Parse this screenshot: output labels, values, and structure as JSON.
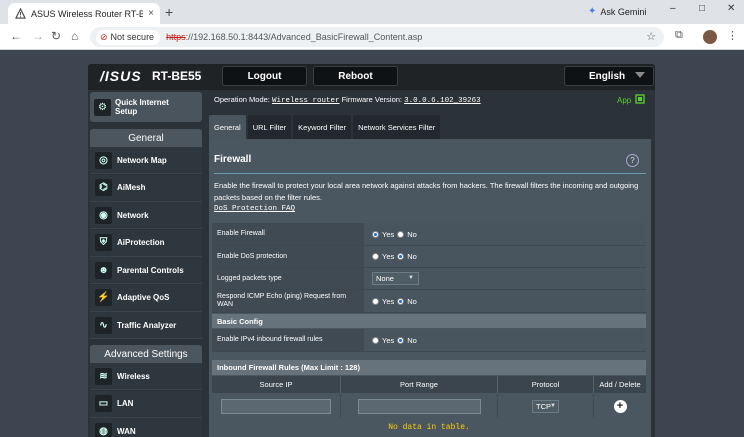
{
  "browser": {
    "tab_title": "ASUS Wireless Router RT-BE55",
    "tab_close": "×",
    "new_tab": "+",
    "gemini_label": "Ask Gemini",
    "not_secure": "Not secure",
    "url_scheme": "https",
    "url_rest": "://192.168.50.1:8443/Advanced_BasicFirewall_Content.asp",
    "minimize": "–",
    "maximize": "□",
    "close": "✕"
  },
  "router": {
    "brand": "/ISUS",
    "model": "RT-BE55",
    "logout": "Logout",
    "reboot": "Reboot",
    "language": "English",
    "qis_label_1": "Quick Internet",
    "qis_label_2": "Setup",
    "opmode_label": "Operation Mode:",
    "opmode_value": "Wireless router",
    "fw_label": "Firmware Version:",
    "fw_value": "3.0.0.6.102_39263",
    "app_label": "App"
  },
  "sidebar": {
    "general_head": "General",
    "general_items": [
      {
        "label": "Network Map",
        "icon": "network-map-icon"
      },
      {
        "label": "AiMesh",
        "icon": "aimesh-icon"
      },
      {
        "label": "Network",
        "icon": "network-icon"
      },
      {
        "label": "AiProtection",
        "icon": "aiprotection-icon"
      },
      {
        "label": "Parental Controls",
        "icon": "parental-controls-icon"
      },
      {
        "label": "Adaptive QoS",
        "icon": "adaptive-qos-icon"
      },
      {
        "label": "Traffic Analyzer",
        "icon": "traffic-analyzer-icon"
      }
    ],
    "advanced_head": "Advanced Settings",
    "advanced_items": [
      {
        "label": "Wireless",
        "icon": "wireless-icon"
      },
      {
        "label": "LAN",
        "icon": "lan-icon"
      },
      {
        "label": "WAN",
        "icon": "wan-icon"
      }
    ]
  },
  "tabs": [
    "General",
    "URL Filter",
    "Keyword Filter",
    "Network Services Filter"
  ],
  "panel": {
    "title": "Firewall",
    "help": "?",
    "description": "Enable the firewall to protect your local area network against attacks from hackers. The firewall filters the incoming and outgoing packets based on the filter rules.",
    "faq_link": "DoS Protection FAQ",
    "yes": "Yes",
    "no": "No",
    "rows": [
      {
        "label": "Enable Firewall",
        "selected": "Yes"
      },
      {
        "label": "Enable DoS protection",
        "selected": "No"
      },
      {
        "label": "Logged packets type",
        "select_value": "None"
      },
      {
        "label": "Respond ICMP Echo (ping) Request from WAN",
        "selected": "No"
      }
    ],
    "basic_config": "Basic Config",
    "ipv4_row": {
      "label": "Enable IPv4 inbound firewall rules",
      "selected": "No"
    },
    "rules_head": "Inbound Firewall Rules (Max Limit : 128)",
    "columns": [
      "Source IP",
      "Port Range",
      "Protocol",
      "Add / Delete"
    ],
    "protocol_value": "TCP",
    "no_data": "No data in table."
  },
  "colors": {
    "accent_green": "#5bcf2f",
    "no_data_yellow": "#ffcc00",
    "insecure_red": "#c5221f"
  }
}
